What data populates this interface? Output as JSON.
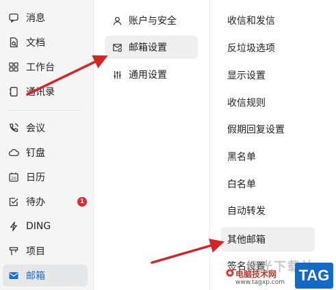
{
  "nav": {
    "items": [
      {
        "label": "消息",
        "icon": "chat-icon"
      },
      {
        "label": "文档",
        "icon": "document-icon"
      },
      {
        "label": "工作台",
        "icon": "grid-icon"
      },
      {
        "label": "通讯录",
        "icon": "contacts-icon"
      },
      {
        "label": "会议",
        "icon": "phone-icon"
      },
      {
        "label": "钉盘",
        "icon": "cloud-icon"
      },
      {
        "label": "日历",
        "icon": "calendar-icon"
      },
      {
        "label": "待办",
        "icon": "checkbox-icon",
        "badge": "1"
      },
      {
        "label": "DING",
        "icon": "lightning-icon"
      },
      {
        "label": "项目",
        "icon": "project-icon"
      },
      {
        "label": "邮箱",
        "icon": "mail-icon",
        "active": true
      }
    ]
  },
  "settings_menu": {
    "items": [
      {
        "label": "账户与安全",
        "icon": "user-icon"
      },
      {
        "label": "邮箱设置",
        "icon": "mailbox-settings-icon",
        "active": true
      },
      {
        "label": "通用设置",
        "icon": "sliders-icon"
      }
    ]
  },
  "mail_settings": {
    "items": [
      {
        "label": "收信和发信"
      },
      {
        "label": "反垃圾选项"
      },
      {
        "label": "显示设置"
      },
      {
        "label": "收信规则"
      },
      {
        "label": "假期回复设置"
      },
      {
        "label": "黑名单"
      },
      {
        "label": "白名单"
      },
      {
        "label": "自动转发"
      },
      {
        "label": "其他邮箱",
        "active": true
      },
      {
        "label": "签名设置"
      }
    ]
  },
  "watermark": {
    "title": "极光下载站",
    "site": "电脑技术网",
    "url": "www.tagxp.com",
    "tag": "TAG"
  },
  "colors": {
    "accent": "#1c6bd6",
    "annotation_arrow": "#d62424",
    "badge": "#e8262c"
  }
}
